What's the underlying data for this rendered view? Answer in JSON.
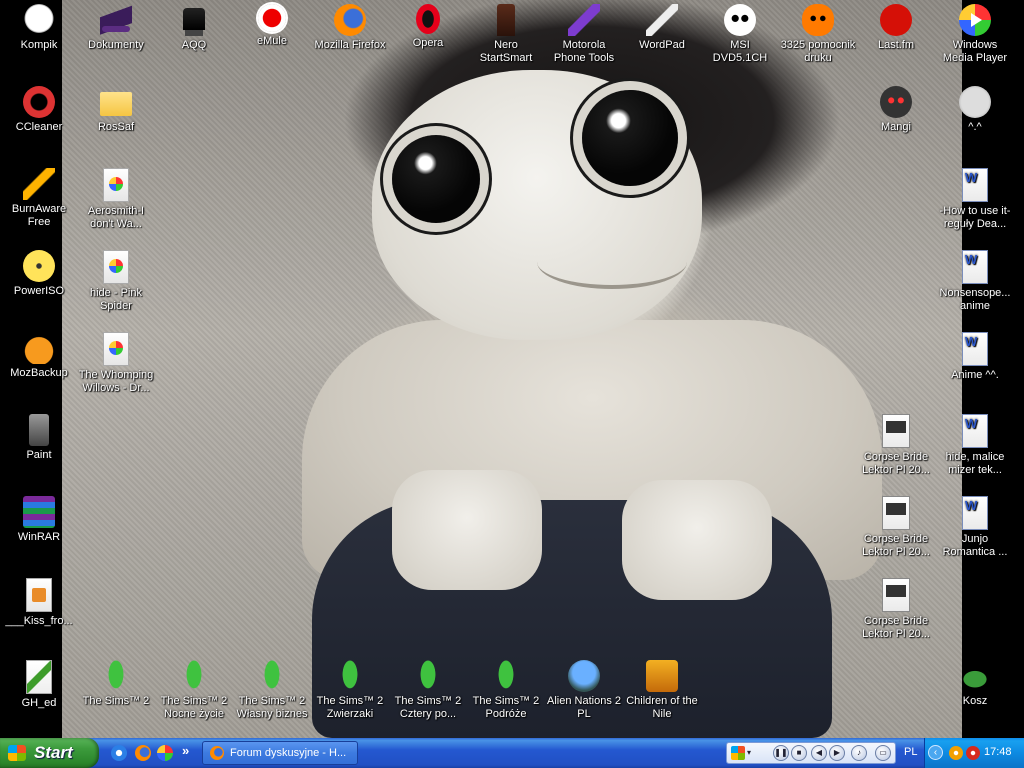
{
  "desktop": {
    "icons": [
      {
        "label": "Kompik",
        "icon": "ghost-icon"
      },
      {
        "label": "Dokumenty",
        "icon": "witch-hat-folder-icon"
      },
      {
        "label": "AQQ",
        "icon": "top-hat-icon"
      },
      {
        "label": "eMule",
        "icon": "emule-icon"
      },
      {
        "label": "Mozilla Firefox",
        "icon": "firefox-icon"
      },
      {
        "label": "Opera",
        "icon": "opera-icon"
      },
      {
        "label": "Nero StartSmart",
        "icon": "nero-icon"
      },
      {
        "label": "Motorola Phone Tools",
        "icon": "vial-icon"
      },
      {
        "label": "WordPad",
        "icon": "wordpad-icon"
      },
      {
        "label": "MSI DVD5.1CH",
        "icon": "panda-icon"
      },
      {
        "label": "3325 pomocnik druku",
        "icon": "pumpkin-icon"
      },
      {
        "label": "Last.fm",
        "icon": "lastfm-icon"
      },
      {
        "label": "Windows Media Player",
        "icon": "windows-media-player-icon"
      },
      {
        "label": "CCleaner",
        "icon": "ccleaner-icon"
      },
      {
        "label": "RosSaf",
        "icon": "folder-icon"
      },
      {
        "label": "Mangi",
        "icon": "mangi-icon"
      },
      {
        "label": "^.^",
        "icon": "smiley-icon"
      },
      {
        "label": "BurnAware Free",
        "icon": "burnaware-icon"
      },
      {
        "label": "Aerosmith-I don't Wa...",
        "icon": "media-file-icon"
      },
      {
        "label": "-How to use it-reguły Dea...",
        "icon": "word-document-icon"
      },
      {
        "label": "PowerISO",
        "icon": "poweriso-icon"
      },
      {
        "label": "hide - Pink Spider",
        "icon": "media-file-icon"
      },
      {
        "label": "Nonsensope... anime",
        "icon": "word-document-icon"
      },
      {
        "label": "MozBackup",
        "icon": "mozbackup-icon"
      },
      {
        "label": "The Whomping Willows - Dr...",
        "icon": "media-file-icon"
      },
      {
        "label": "Anime ^^.",
        "icon": "word-document-icon"
      },
      {
        "label": "Paint",
        "icon": "paint-icon"
      },
      {
        "label": "Corpse Bride Lektor Pl 20...",
        "icon": "video-file-icon"
      },
      {
        "label": "hide, malice mizer tek...",
        "icon": "word-document-icon"
      },
      {
        "label": "WinRAR",
        "icon": "winrar-icon"
      },
      {
        "label": "Corpse Bride Lektor Pl 20...",
        "icon": "video-file-icon"
      },
      {
        "label": "Junjo Romantica ...",
        "icon": "word-document-icon"
      },
      {
        "label": "___Kiss_fro...",
        "icon": "image-file-icon"
      },
      {
        "label": "Corpse Bride Lektor Pl 20...",
        "icon": "video-file-icon"
      },
      {
        "label": "GH_ed",
        "icon": "gh-ed-icon"
      },
      {
        "label": "The Sims™ 2",
        "icon": "sims-icon"
      },
      {
        "label": "The Sims™ 2 Nocne życie",
        "icon": "sims-icon"
      },
      {
        "label": "The Sims™ 2 Własny biznes",
        "icon": "sims-icon"
      },
      {
        "label": "The Sims™ 2 Zwierzaki",
        "icon": "sims-icon"
      },
      {
        "label": "The Sims™ 2 Cztery po...",
        "icon": "sims-icon"
      },
      {
        "label": "The Sims™ 2 Podróże",
        "icon": "sims-icon"
      },
      {
        "label": "Alien Nations 2 PL",
        "icon": "alien-nations-icon"
      },
      {
        "label": "Children of the Nile",
        "icon": "children-of-the-nile-icon"
      },
      {
        "label": "Kosz",
        "icon": "recycle-bin-icon"
      }
    ]
  },
  "taskbar": {
    "start_label": "Start",
    "quick_launch_more": "»",
    "active_task_label": "Forum dyskusyjne - H...",
    "media_toolbar_menu": "▾",
    "language": "PL",
    "tray_chevron": "‹",
    "clock": "17:48",
    "colors": {
      "taskbar": "#2458d0",
      "start": "#3c9b3c",
      "tray": "#0d8ae2"
    }
  }
}
